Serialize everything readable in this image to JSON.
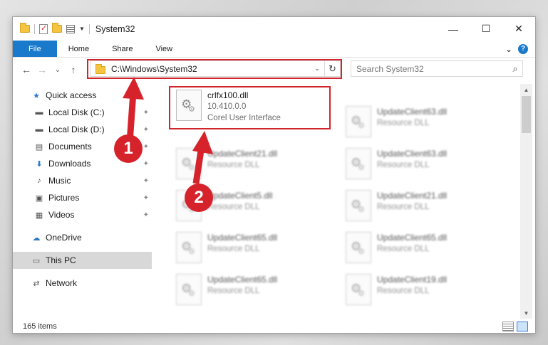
{
  "window": {
    "title": "System32",
    "controls": {
      "minimize": "—",
      "maximize": "☐",
      "close": "✕"
    }
  },
  "ribbon": {
    "tabs": [
      "File",
      "Home",
      "Share",
      "View"
    ],
    "expand": "⌄",
    "help": "?"
  },
  "nav": {
    "back": "←",
    "forward": "→",
    "recent": "⌄",
    "up": "↑",
    "address": "C:\\Windows\\System32",
    "address_dropdown": "⌄",
    "refresh": "↻",
    "search_placeholder": "Search System32",
    "search_icon": "⌕"
  },
  "sidebar": {
    "items": [
      {
        "label": "Quick access",
        "icon": "star-icon",
        "glyph": "★",
        "pinned": false
      },
      {
        "label": "Local Disk (C:)",
        "icon": "drive-icon",
        "glyph": "▬",
        "pinned": true
      },
      {
        "label": "Local Disk (D:)",
        "icon": "drive-icon",
        "glyph": "▬",
        "pinned": true
      },
      {
        "label": "Documents",
        "icon": "document-icon",
        "glyph": "▤",
        "pinned": true
      },
      {
        "label": "Downloads",
        "icon": "download-icon",
        "glyph": "⬇",
        "pinned": true
      },
      {
        "label": "Music",
        "icon": "music-icon",
        "glyph": "♪",
        "pinned": true
      },
      {
        "label": "Pictures",
        "icon": "picture-icon",
        "glyph": "▣",
        "pinned": true
      },
      {
        "label": "Videos",
        "icon": "video-icon",
        "glyph": "▦",
        "pinned": true
      },
      {
        "label": "OneDrive",
        "icon": "cloud-icon",
        "glyph": "☁",
        "pinned": false
      },
      {
        "label": "This PC",
        "icon": "computer-icon",
        "glyph": "▭",
        "pinned": false
      },
      {
        "label": "Network",
        "icon": "network-icon",
        "glyph": "⇄",
        "pinned": false
      }
    ],
    "pin_glyph": "📌"
  },
  "files": {
    "highlighted": {
      "name": "crlfx100.dll",
      "version": "10.410.0.0",
      "description": "Corel User Interface"
    },
    "left_column": [
      {
        "name": "UpdateClient21.dll",
        "type": "Resource DLL"
      },
      {
        "name": "UpdateClient5.dll",
        "type": "Resource DLL"
      },
      {
        "name": "UpdateClient65.dll",
        "type": "Resource DLL"
      },
      {
        "name": "UpdateClient65.dll",
        "type": "Resource DLL"
      }
    ],
    "right_column": [
      {
        "name": "UpdateClient63.dll",
        "type": "Resource DLL"
      },
      {
        "name": "UpdateClient63.dll",
        "type": "Resource DLL"
      },
      {
        "name": "UpdateClient21.dll",
        "type": "Resource DLL"
      },
      {
        "name": "UpdateClient65.dll",
        "type": "Resource DLL"
      },
      {
        "name": "UpdateClient19.dll",
        "type": "Resource DLL"
      }
    ]
  },
  "status": {
    "item_count": "165 items"
  },
  "annotations": {
    "badge_1": "1",
    "badge_2": "2",
    "accent_color": "#d6232b"
  }
}
